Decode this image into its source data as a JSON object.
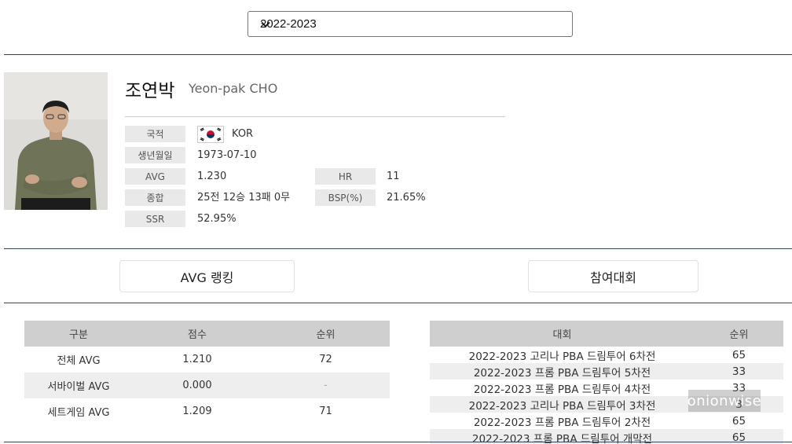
{
  "season_select": {
    "selected": "2022-2023"
  },
  "player": {
    "name_ko": "조연박",
    "name_en": "Yeon-pak CHO",
    "fields": {
      "nationality_label": "국적",
      "nationality_value": "KOR",
      "birth_label": "생년월일",
      "birth_value": "1973-07-10",
      "avg_label": "AVG",
      "avg_value": "1.230",
      "hr_label": "HR",
      "hr_value": "11",
      "total_label": "종합",
      "total_value": "25전 12승 13패 0무",
      "bsp_label": "BSP(%)",
      "bsp_value": "21.65%",
      "ssr_label": "SSR",
      "ssr_value": "52.95%"
    }
  },
  "tabs": {
    "avg_ranking": "AVG 랭킹",
    "tournaments": "참여대회"
  },
  "avg_table": {
    "headers": [
      "구분",
      "점수",
      "순위"
    ],
    "rows": [
      [
        "전체 AVG",
        "1.210",
        "72"
      ],
      [
        "서바이벌 AVG",
        "0.000",
        "-"
      ],
      [
        "세트게임 AVG",
        "1.209",
        "71"
      ]
    ]
  },
  "tournament_table": {
    "headers": [
      "대회",
      "순위"
    ],
    "rows": [
      [
        "2022-2023 고리나 PBA 드림투어 6차전",
        "65"
      ],
      [
        "2022-2023 프롬 PBA 드림투어 5차전",
        "33"
      ],
      [
        "2022-2023 프롬 PBA 드림투어 4차전",
        "33"
      ],
      [
        "2022-2023 고리나 PBA 드림투어 3차전",
        "3"
      ],
      [
        "2022-2023 프롬 PBA 드림투어 2차전",
        "65"
      ],
      [
        "2022-2023 프롬 PBA 드림투어 개막전",
        "65"
      ]
    ]
  },
  "watermark": "onionwise"
}
